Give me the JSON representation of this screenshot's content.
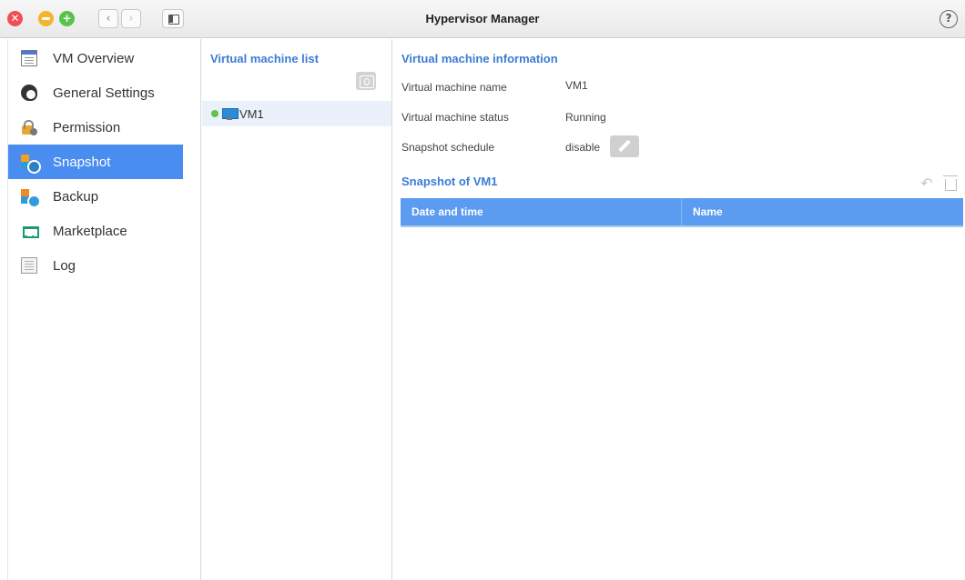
{
  "window": {
    "title": "Hypervisor Manager",
    "controls": {
      "close_glyph": "✕",
      "maximize_glyph": "+"
    },
    "back_glyph": "‹",
    "forward_glyph": "›",
    "help_glyph": "?"
  },
  "sidebar": {
    "items": [
      {
        "label": "VM Overview",
        "icon": "vm-overview-icon",
        "active": false
      },
      {
        "label": "General Settings",
        "icon": "gear-icon",
        "active": false
      },
      {
        "label": "Permission",
        "icon": "lock-icon",
        "active": false
      },
      {
        "label": "Snapshot",
        "icon": "snapshot-icon",
        "active": true
      },
      {
        "label": "Backup",
        "icon": "backup-icon",
        "active": false
      },
      {
        "label": "Marketplace",
        "icon": "cart-icon",
        "active": false
      },
      {
        "label": "Log",
        "icon": "log-icon",
        "active": false
      }
    ],
    "active_color": "#4a8df0"
  },
  "vm_list": {
    "title": "Virtual machine list",
    "items": [
      {
        "name": "VM1",
        "status_color": "#63c24a"
      }
    ]
  },
  "vm_info": {
    "title": "Virtual machine information",
    "rows": [
      {
        "label": "Virtual machine name",
        "value": "VM1"
      },
      {
        "label": "Virtual machine status",
        "value": "Running"
      },
      {
        "label": "Snapshot schedule",
        "value": "disable"
      }
    ]
  },
  "snapshots": {
    "title": "Snapshot of VM1",
    "restore_glyph": "↶",
    "columns": [
      "Date and time",
      "Name"
    ],
    "rows": [],
    "header_color": "#5b9bf0"
  },
  "accent_color": "#3a7bd5"
}
